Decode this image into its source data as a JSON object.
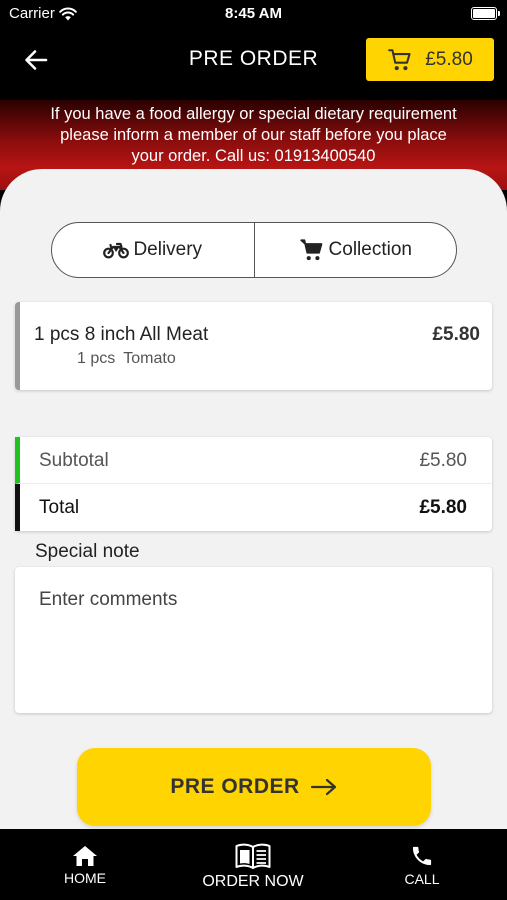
{
  "status_bar": {
    "carrier": "Carrier",
    "time": "8:45 AM"
  },
  "header": {
    "title": "PRE ORDER",
    "cart_total": "£5.80"
  },
  "allergy_notice": {
    "line1": "If you have a food allergy or special dietary requirement",
    "line2": "please inform a member of our staff before you place",
    "line3": "your order. Call us: 01913400540"
  },
  "delivery_toggle": {
    "delivery_label": "Delivery",
    "collection_label": "Collection"
  },
  "order_items": [
    {
      "qty_name": "1 pcs 8 inch All Meat",
      "price": "£5.80",
      "extra_qty": "1 pcs",
      "extra_name": "Tomato"
    }
  ],
  "totals": {
    "subtotal_label": "Subtotal",
    "subtotal_value": "£5.80",
    "total_label": "Total",
    "total_value": "£5.80"
  },
  "special_note": {
    "label": "Special note",
    "placeholder": "Enter comments"
  },
  "submit": {
    "label": "PRE ORDER"
  },
  "tabbar": {
    "home": "HOME",
    "order_now": "ORDER NOW",
    "call": "CALL"
  },
  "colors": {
    "accent": "#ffd400",
    "subtotal_bar": "#1fc21f",
    "banner_red": "#b81414"
  }
}
